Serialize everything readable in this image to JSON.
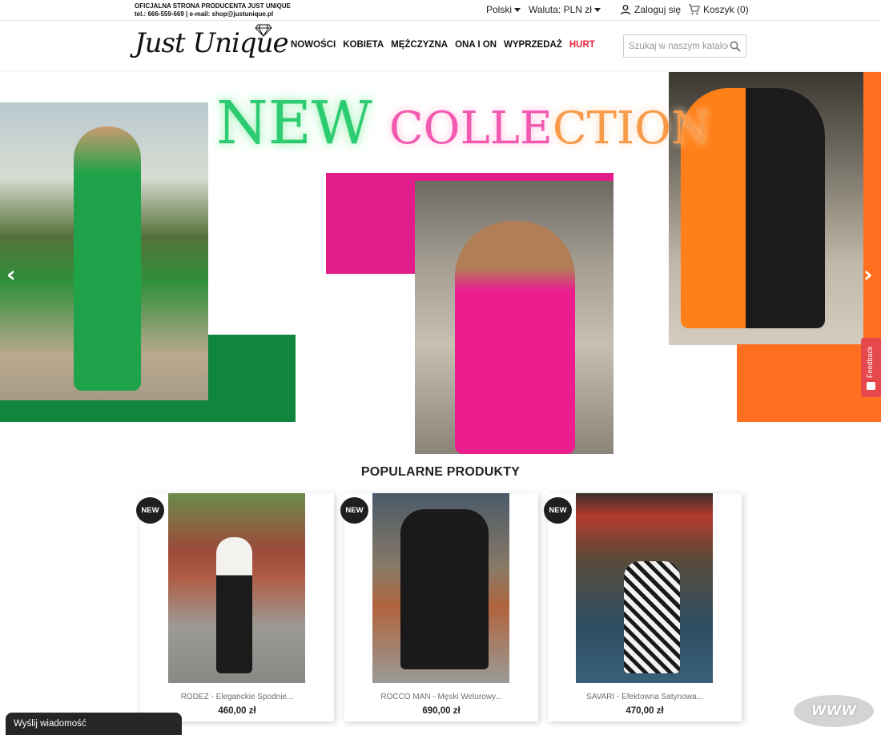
{
  "topbar": {
    "info_line1": "OFICJALNA STRONA PRODUCENTA JUST UNIQUE",
    "info_line2": "tel.: 666-559-669  |  e-mail: shop@justunique.pl",
    "language": "Polski",
    "currency": "Waluta: PLN zł",
    "login": "Zaloguj się",
    "cart": "Koszyk (0)"
  },
  "header": {
    "logo": "Just Unique",
    "nav": [
      "NOWOŚCI",
      "KOBIETA",
      "MĘŻCZYZNA",
      "ONA I ON",
      "WYPRZEDAŻ",
      "HURT"
    ],
    "search_placeholder": "Szukaj w naszym katalogu"
  },
  "hero": {
    "headline_word1": "NEW",
    "headline_word2": "COLLE",
    "headline_word3": "CTION",
    "prev": "‹",
    "next": "›"
  },
  "feedback": "Feedback",
  "section_title": "POPULARNE PRODUKTY",
  "products": [
    {
      "badge": "NEW",
      "name": "RODEZ - Eleganckie Spodnie...",
      "price": "460,00 zł"
    },
    {
      "badge": "NEW",
      "name": "ROCCO MAN - Męski Welurowy...",
      "price": "690,00 zł"
    },
    {
      "badge": "NEW",
      "name": "SAVARI - Efektowna Satynowa...",
      "price": "470,00 zł"
    }
  ],
  "chat": "Wyślij wiadomość",
  "www_badge": "WWW",
  "colors": {
    "accent_red": "#e4233d",
    "green": "#10853e",
    "pink": "#e11d8a",
    "orange": "#ff6f1f"
  }
}
